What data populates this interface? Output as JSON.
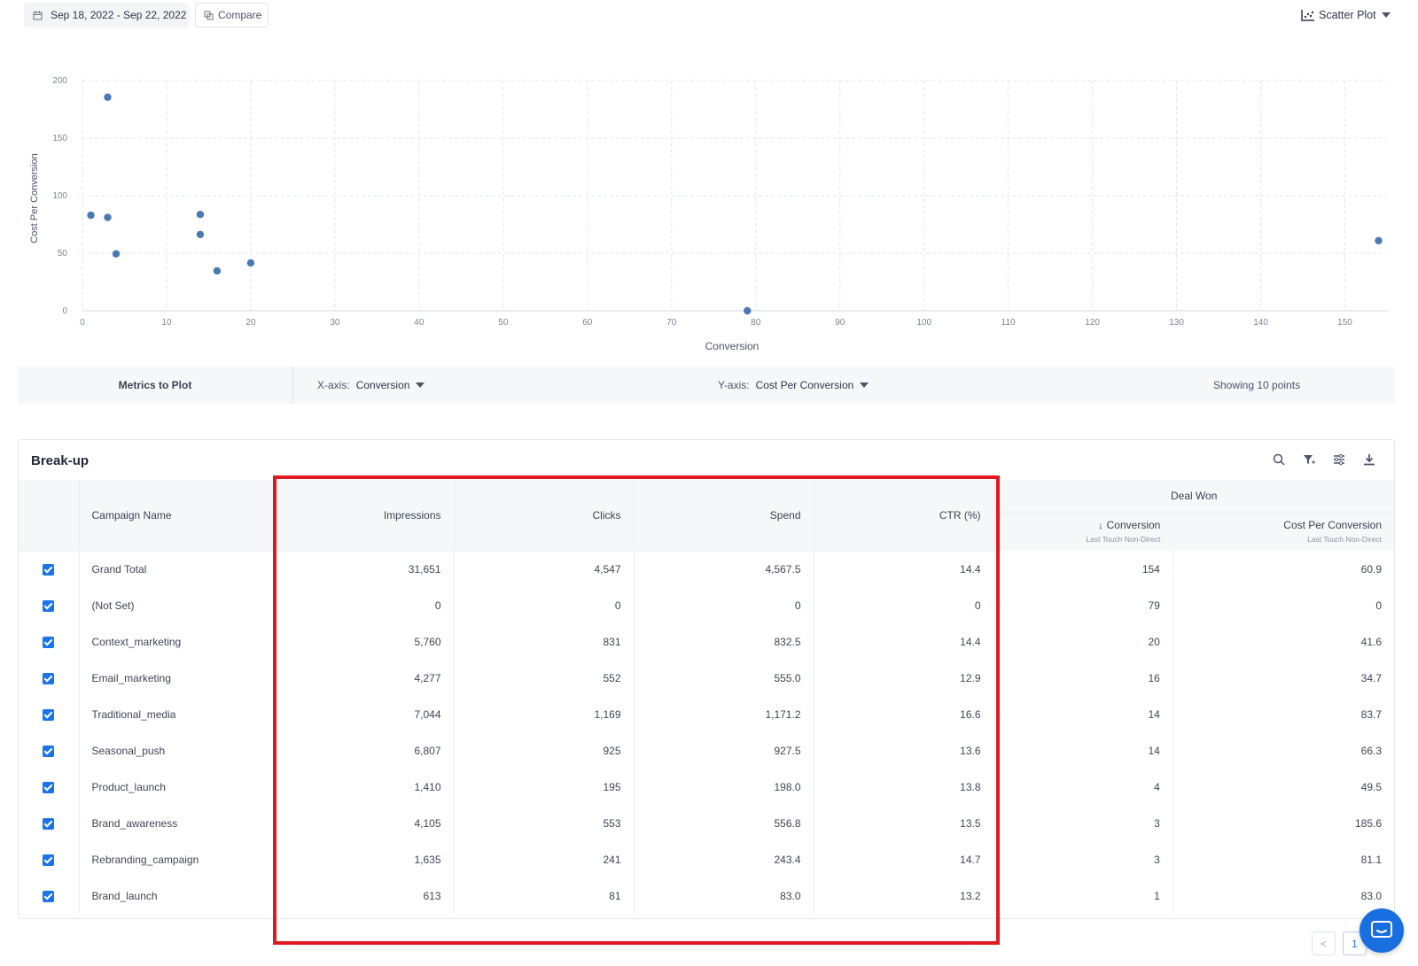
{
  "toolbar": {
    "date_range": "Sep 18, 2022 - Sep 22, 2022",
    "compare_label": "Compare",
    "plot_type": "Scatter Plot"
  },
  "chart_data": {
    "type": "scatter",
    "xlabel": "Conversion",
    "ylabel": "Cost Per Conversion",
    "xlim": [
      0,
      155
    ],
    "ylim": [
      0,
      200
    ],
    "xticks": [
      0,
      10,
      20,
      30,
      40,
      50,
      60,
      70,
      80,
      90,
      100,
      110,
      120,
      130,
      140,
      150
    ],
    "yticks": [
      0,
      50,
      100,
      150,
      200
    ],
    "grid": true,
    "color": "#4a78b3",
    "points": [
      {
        "x": 154,
        "y": 60.9
      },
      {
        "x": 79,
        "y": 0
      },
      {
        "x": 20,
        "y": 41.6
      },
      {
        "x": 16,
        "y": 34.7
      },
      {
        "x": 14,
        "y": 83.7
      },
      {
        "x": 14,
        "y": 66.3
      },
      {
        "x": 4,
        "y": 49.5
      },
      {
        "x": 3,
        "y": 185.6
      },
      {
        "x": 3,
        "y": 81.1
      },
      {
        "x": 1,
        "y": 83.0
      }
    ]
  },
  "metrics": {
    "title": "Metrics to Plot",
    "x_axis_label": "X-axis:",
    "x_axis_value": "Conversion",
    "y_axis_label": "Y-axis:",
    "y_axis_value": "Cost Per Conversion",
    "showing": "Showing 10 points"
  },
  "table": {
    "title": "Break-up",
    "headers": {
      "campaign": "Campaign Name",
      "impressions": "Impressions",
      "clicks": "Clicks",
      "spend": "Spend",
      "ctr": "CTR (%)",
      "group": "Deal Won",
      "conversion": "Conversion",
      "conversion_sub": "Last Touch Non-Direct",
      "cpc": "Cost Per Conversion",
      "cpc_sub": "Last Touch Non-Direct"
    },
    "rows": [
      {
        "name": "Grand Total",
        "impressions": "31,651",
        "clicks": "4,547",
        "spend": "4,567.5",
        "ctr": "14.4",
        "conversion": "154",
        "cpc": "60.9"
      },
      {
        "name": "(Not Set)",
        "impressions": "0",
        "clicks": "0",
        "spend": "0",
        "ctr": "0",
        "conversion": "79",
        "cpc": "0"
      },
      {
        "name": "Context_marketing",
        "impressions": "5,760",
        "clicks": "831",
        "spend": "832.5",
        "ctr": "14.4",
        "conversion": "20",
        "cpc": "41.6"
      },
      {
        "name": "Email_marketing",
        "impressions": "4,277",
        "clicks": "552",
        "spend": "555.0",
        "ctr": "12.9",
        "conversion": "16",
        "cpc": "34.7"
      },
      {
        "name": "Traditional_media",
        "impressions": "7,044",
        "clicks": "1,169",
        "spend": "1,171.2",
        "ctr": "16.6",
        "conversion": "14",
        "cpc": "83.7"
      },
      {
        "name": "Seasonal_push",
        "impressions": "6,807",
        "clicks": "925",
        "spend": "927.5",
        "ctr": "13.6",
        "conversion": "14",
        "cpc": "66.3"
      },
      {
        "name": "Product_launch",
        "impressions": "1,410",
        "clicks": "195",
        "spend": "198.0",
        "ctr": "13.8",
        "conversion": "4",
        "cpc": "49.5"
      },
      {
        "name": "Brand_awareness",
        "impressions": "4,105",
        "clicks": "553",
        "spend": "556.8",
        "ctr": "13.5",
        "conversion": "3",
        "cpc": "185.6"
      },
      {
        "name": "Rebranding_campaign",
        "impressions": "1,635",
        "clicks": "241",
        "spend": "243.4",
        "ctr": "14.7",
        "conversion": "3",
        "cpc": "81.1"
      },
      {
        "name": "Brand_launch",
        "impressions": "613",
        "clicks": "81",
        "spend": "83.0",
        "ctr": "13.2",
        "conversion": "1",
        "cpc": "83.0"
      }
    ]
  },
  "pagination": {
    "prev": "<",
    "current": "1"
  },
  "colors": {
    "accent": "#1a73e8",
    "highlight": "#e0181f",
    "point": "#4a78b3"
  }
}
